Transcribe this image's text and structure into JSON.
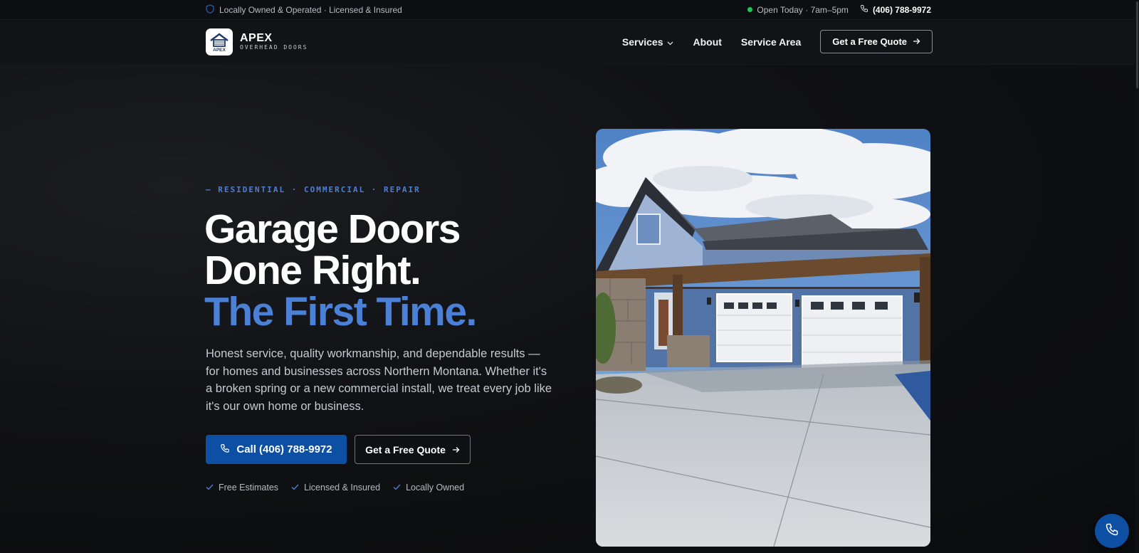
{
  "topbar": {
    "left_text": "Locally Owned & Operated · Licensed & Insured",
    "status_text": "Open Today · 7am–5pm",
    "phone": "(406) 788-9972",
    "status_color": "#22c55e"
  },
  "brand": {
    "name": "APEX",
    "sub": "OVERHEAD DOORS",
    "mark_text": "APEX"
  },
  "nav": {
    "items": [
      {
        "label": "Services"
      },
      {
        "label": "About"
      },
      {
        "label": "Service Area"
      }
    ],
    "cta": "Get a Free Quote"
  },
  "hero": {
    "eyebrow": "— RESIDENTIAL · COMMERCIAL · REPAIR",
    "headline_line1": "Garage Doors",
    "headline_line2": "Done Right.",
    "headline_line3": "The First Time.",
    "description": "Honest service, quality workmanship, and dependable results — for homes and businesses across Northern Montana. Whether it's a broken spring or a new commercial install, we treat every job like it's our own home or business.",
    "call_button": "Call (406) 788-9972",
    "quote_button": "Get a Free Quote",
    "badges": [
      "Free Estimates",
      "Licensed & Insured",
      "Locally Owned"
    ]
  },
  "colors": {
    "accent": "#4a80d6",
    "primary_button": "#0d4fa3",
    "background": "#0c0d10"
  },
  "icons": {
    "topbar_left": "shield-icon",
    "topbar_phone": "phone-icon",
    "services_caret": "chevron-down-icon",
    "cta_arrow": "arrow-right-icon",
    "badge_check": "check-icon",
    "fab": "phone-icon"
  }
}
